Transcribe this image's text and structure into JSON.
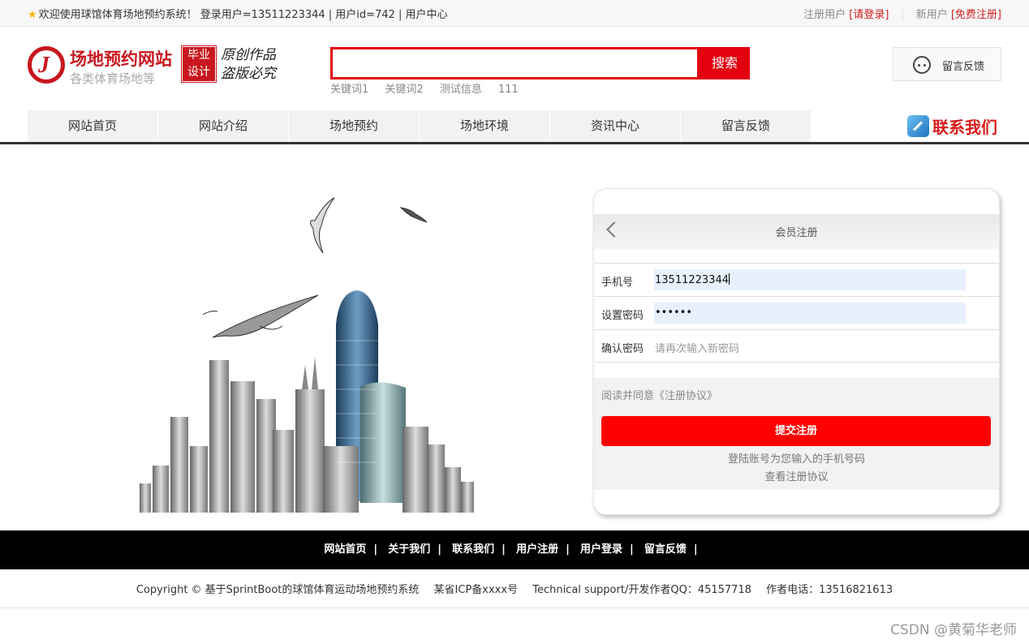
{
  "topbar": {
    "welcome": "欢迎使用球馆体育场地预约系统！ 登录用户=13511223344 | 用户id=742 | 用户中心",
    "register_user": "注册用户",
    "login_link": "[请登录]",
    "new_user": "新用户",
    "free_register": "[免费注册]"
  },
  "header": {
    "site_name": "场地预约网站",
    "site_sub": "各类体育场地等",
    "badge_line1": "毕业",
    "badge_line2": "设计",
    "motto_line1": "原创作品",
    "motto_line2": "盗版必究",
    "search_value": "",
    "search_button": "搜索",
    "keywords": [
      "关键词1",
      "关键词2",
      "测试信息",
      "111"
    ],
    "feedback_button": "留言反馈"
  },
  "nav": {
    "items": [
      "网站首页",
      "网站介绍",
      "场地预约",
      "场地环境",
      "资讯中心",
      "留言反馈"
    ],
    "contact": "联系我们"
  },
  "register": {
    "title": "会员注册",
    "phone_label": "手机号",
    "phone_value": "13511223344",
    "password_label": "设置密码",
    "password_value": "••••••",
    "confirm_label": "确认密码",
    "confirm_placeholder": "请再次输入新密码",
    "agreement": "阅读并同意《注册协议》",
    "submit": "提交注册",
    "hint1": "登陆账号为您输入的手机号码",
    "hint2": "查看注册协议"
  },
  "footer": {
    "links": [
      "网站首页",
      "关于我们",
      "联系我们",
      "用户注册",
      "用户登录",
      "留言反馈"
    ],
    "copyright": "Copyright © 基于SprintBoot的球馆体育运动场地预约系统",
    "icp": "某省ICP备xxxx号",
    "support": "Technical support/开发作者QQ：45157718",
    "phone": "作者电话：13516821613",
    "watermark": "CSDN @黄菊华老师"
  },
  "colors": {
    "brand_red": "#c8171e",
    "search_red": "#e4000f",
    "submit_red": "#fe0000",
    "footer_bg": "#000000"
  }
}
